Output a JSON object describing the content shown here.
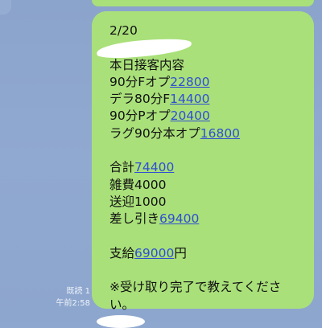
{
  "message": {
    "date": "2/20",
    "heading": "本日接客内容",
    "items": [
      {
        "label": "90分Fオプ",
        "amount": "22800"
      },
      {
        "label": "デラ80分F",
        "amount": "14400"
      },
      {
        "label": "90分Pオプ",
        "amount": "20400"
      },
      {
        "label": "ラグ90分本オプ",
        "amount": "16800"
      }
    ],
    "total_label": "合計",
    "total_amount": "74400",
    "misc": "雑費4000",
    "transport": "送迎1000",
    "net_label": "差し引き",
    "net_amount": "69400",
    "pay_label": "支給",
    "pay_amount": "69000",
    "pay_unit": "円",
    "note_line1": "※受け取り完了で教えてくださ",
    "note_line2": "い。"
  },
  "meta": {
    "read_status": "既読 1",
    "timestamp": "午前2:58"
  },
  "colors": {
    "bubble": "#a9e07a",
    "background": "#8ea7cf",
    "link": "#2f4fd3"
  }
}
